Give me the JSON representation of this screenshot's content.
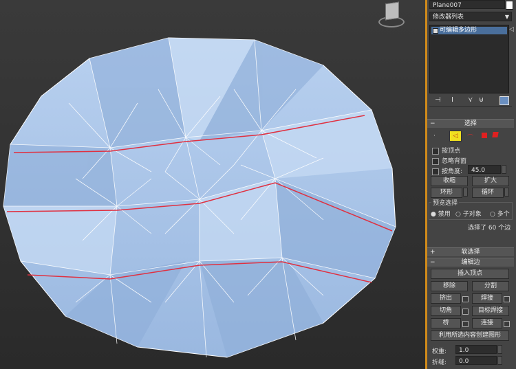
{
  "panel": {
    "object_name": "Plane007",
    "modifier_list": "修改器列表",
    "stack_item": "可编辑多边形",
    "rollouts": {
      "selection": "选择",
      "soft_selection": "软选择",
      "edit_edges": "编辑边"
    },
    "selection": {
      "by_vertex": "按顶点",
      "ignore_backfacing": "忽略背面",
      "by_angle": "按角度:",
      "angle_value": "45.0",
      "shrink": "收缩",
      "grow": "扩大",
      "ring": "环形",
      "loop": "循环",
      "preview_label": "预览选择",
      "preview_off": "禁用",
      "preview_subobj": "子对象",
      "preview_multi": "多个",
      "status": "选择了 60 个边"
    },
    "edit_edges": {
      "insert_vertex": "插入顶点",
      "remove": "移除",
      "split": "分割",
      "extrude": "挤出",
      "weld": "焊接",
      "chamfer": "切角",
      "target_weld": "目标焊接",
      "bridge": "桥",
      "connect": "连接",
      "create_shape": "利用所选内容创建图形",
      "weight_label": "权重:",
      "weight_value": "1.0",
      "crease_label": "折缝:",
      "crease_value": "0.0"
    }
  },
  "colors": {
    "mesh_fill": "#a9c3e6",
    "mesh_edge": "#ffffff",
    "selected_edge": "#e03040",
    "accent": "#d08a1a"
  }
}
